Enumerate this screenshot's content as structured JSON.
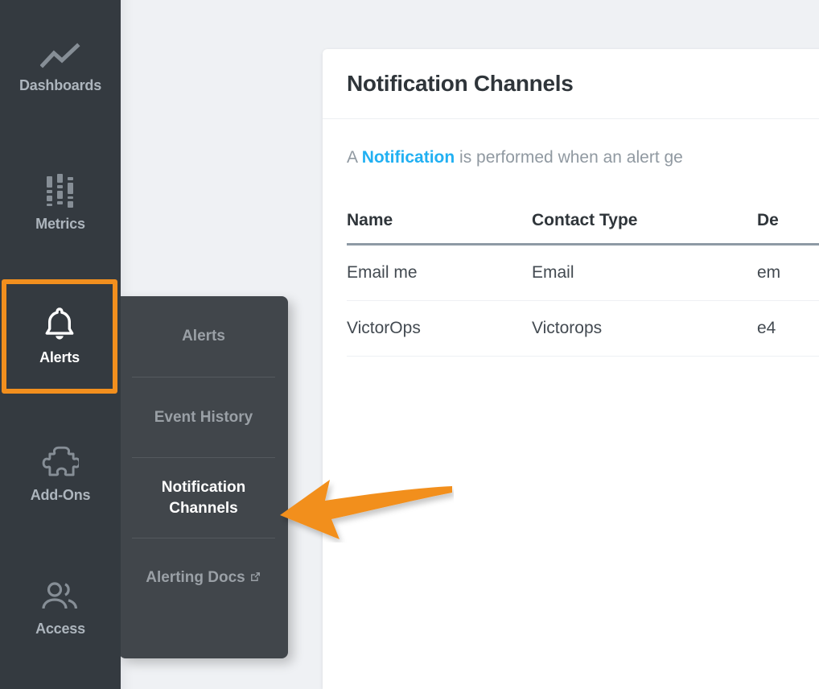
{
  "colors": {
    "nav_bg": "#343a40",
    "flyout_bg": "#41464b",
    "accent_orange": "#f28f1e",
    "link_blue": "#21b0f2",
    "workspace_bg": "#eff1f4",
    "card_bg": "#ffffff",
    "nav_label": "#adb5bd",
    "table_rule": "#8e9aa5"
  },
  "sidebar": {
    "items": [
      {
        "label": "Dashboards",
        "icon": "line-chart-icon",
        "active": false
      },
      {
        "label": "Metrics",
        "icon": "metrics-bars-icon",
        "active": false
      },
      {
        "label": "Alerts",
        "icon": "bell-icon",
        "active": true
      },
      {
        "label": "Add-Ons",
        "icon": "puzzle-piece-icon",
        "active": false
      },
      {
        "label": "Access",
        "icon": "users-icon",
        "active": false
      }
    ]
  },
  "flyout": {
    "parent": "Alerts",
    "items": [
      {
        "label": "Alerts",
        "current": false,
        "external": false
      },
      {
        "label": "Event History",
        "current": false,
        "external": false
      },
      {
        "label": "Notification Channels",
        "current": true,
        "external": false
      },
      {
        "label": "Alerting Docs",
        "current": false,
        "external": true,
        "external_icon": "external-link-icon"
      }
    ]
  },
  "card": {
    "title": "Notification Channels",
    "lede": {
      "before": "A ",
      "highlight": "Notification",
      "after": " is performed when an alert ge"
    }
  },
  "table": {
    "columns": [
      "Name",
      "Contact Type",
      "De"
    ],
    "rows": [
      {
        "name": "Email me",
        "contact_type": "Email",
        "detail": "em"
      },
      {
        "name": "VictorOps",
        "contact_type": "Victorops",
        "detail": "e4"
      }
    ]
  },
  "annotation": {
    "arrow": {
      "name": "orange-pointer-arrow",
      "direction": "left",
      "points_at": "Notification Channels",
      "color": "#f28f1e"
    }
  }
}
